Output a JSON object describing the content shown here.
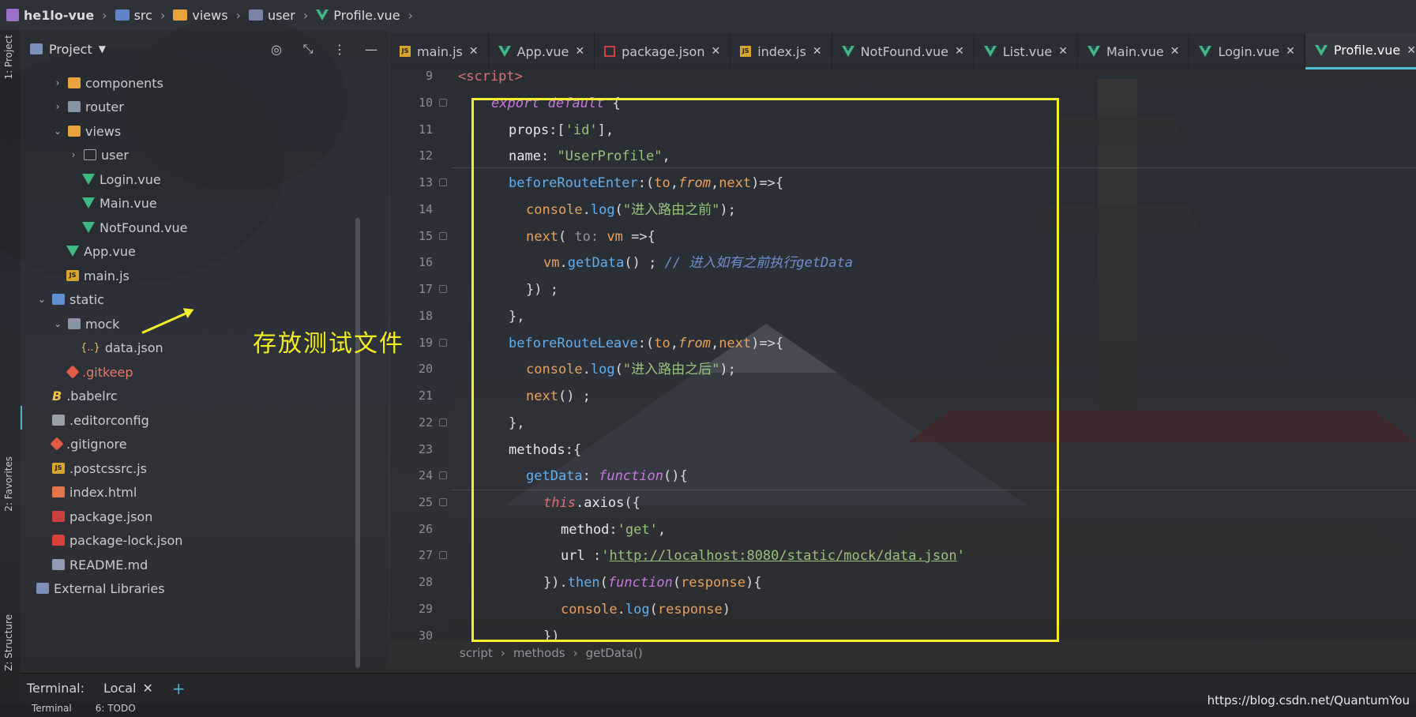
{
  "breadcrumb": {
    "items": [
      "he1lo-vue",
      "src",
      "views",
      "user",
      "Profile.vue"
    ]
  },
  "left_strip": {
    "project_tab": "1: Project",
    "favorites_tab": "2: Favorites",
    "structure_tab": "Z: Structure"
  },
  "project_panel": {
    "title": "Project",
    "tree": [
      {
        "label": "components",
        "icon": "folder-icon"
      },
      {
        "label": "router",
        "icon": "folder-icon"
      },
      {
        "label": "views",
        "icon": "folder-icon"
      },
      {
        "label": "user",
        "icon": "folder-icon"
      },
      {
        "label": "Login.vue",
        "icon": "vue-file-icon"
      },
      {
        "label": "Main.vue",
        "icon": "vue-file-icon"
      },
      {
        "label": "NotFound.vue",
        "icon": "vue-file-icon"
      },
      {
        "label": "App.vue",
        "icon": "vue-file-icon"
      },
      {
        "label": "main.js",
        "icon": "js-file-icon"
      },
      {
        "label": "static",
        "icon": "folder-icon"
      },
      {
        "label": "mock",
        "icon": "folder-icon"
      },
      {
        "label": "data.json",
        "icon": "json-file-icon"
      },
      {
        "label": ".gitkeep",
        "icon": "git-file-icon"
      },
      {
        "label": ".babelrc",
        "icon": "babel-file-icon"
      },
      {
        "label": ".editorconfig",
        "icon": "config-file-icon"
      },
      {
        "label": ".gitignore",
        "icon": "git-file-icon"
      },
      {
        "label": ".postcssrc.js",
        "icon": "js-file-icon"
      },
      {
        "label": "index.html",
        "icon": "html-file-icon"
      },
      {
        "label": "package.json",
        "icon": "package-file-icon"
      },
      {
        "label": "package-lock.json",
        "icon": "lock-file-icon"
      },
      {
        "label": "README.md",
        "icon": "markdown-file-icon"
      },
      {
        "label": "External Libraries",
        "icon": "library-icon"
      }
    ]
  },
  "annotation": {
    "text": "存放测试文件",
    "color": "#f2ee1c"
  },
  "tabs": [
    {
      "label": "main.js",
      "icon": "js-file-icon"
    },
    {
      "label": "App.vue",
      "icon": "vue-file-icon"
    },
    {
      "label": "package.json",
      "icon": "package-file-icon"
    },
    {
      "label": "index.js",
      "icon": "js-file-icon"
    },
    {
      "label": "NotFound.vue",
      "icon": "vue-file-icon"
    },
    {
      "label": "List.vue",
      "icon": "vue-file-icon"
    },
    {
      "label": "Main.vue",
      "icon": "vue-file-icon"
    },
    {
      "label": "Login.vue",
      "icon": "vue-file-icon"
    },
    {
      "label": "Profile.vue",
      "icon": "vue-file-icon",
      "active": true
    }
  ],
  "editor": {
    "line_numbers": [
      "9",
      "10",
      "11",
      "12",
      "13",
      "14",
      "15",
      "16",
      "17",
      "18",
      "19",
      "20",
      "21",
      "22",
      "23",
      "24",
      "25",
      "26",
      "27",
      "28",
      "29",
      "30"
    ],
    "code_breadcrumb": [
      "script",
      "methods",
      "getData()"
    ]
  },
  "terminal": {
    "label": "Terminal:",
    "tab": "Local"
  },
  "bottom_tabs": [
    "Terminal",
    "6: TODO"
  ],
  "watermark": "https://blog.csdn.net/QuantumYou"
}
